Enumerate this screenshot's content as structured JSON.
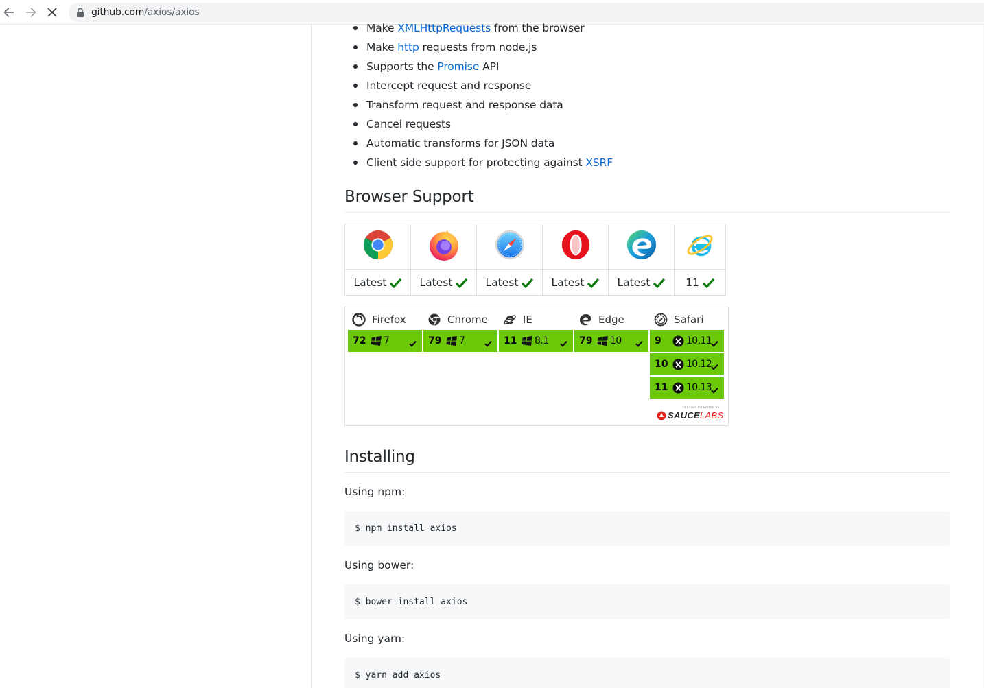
{
  "browser": {
    "url_host": "github.com",
    "url_path": "/axios/axios"
  },
  "features": [
    {
      "before": "Make ",
      "link": "XMLHttpRequests",
      "after": " from the browser"
    },
    {
      "before": "Make ",
      "link": "http",
      "after": " requests from node.js"
    },
    {
      "before": "Supports the ",
      "link": "Promise",
      "after": " API"
    },
    {
      "before": "Intercept request and response",
      "link": "",
      "after": ""
    },
    {
      "before": "Transform request and response data",
      "link": "",
      "after": ""
    },
    {
      "before": "Cancel requests",
      "link": "",
      "after": ""
    },
    {
      "before": "Automatic transforms for JSON data",
      "link": "",
      "after": ""
    },
    {
      "before": "Client side support for protecting against ",
      "link": "XSRF",
      "after": ""
    }
  ],
  "browser_support": {
    "heading": "Browser Support",
    "browsers": [
      {
        "icon": "chrome-logo-icon",
        "label": "Latest"
      },
      {
        "icon": "firefox-logo-icon",
        "label": "Latest"
      },
      {
        "icon": "safari-logo-icon",
        "label": "Latest"
      },
      {
        "icon": "opera-logo-icon",
        "label": "Latest"
      },
      {
        "icon": "edge-logo-icon",
        "label": "Latest"
      },
      {
        "icon": "ie-logo-icon",
        "label": "11"
      }
    ]
  },
  "sauce_matrix": {
    "columns": [
      {
        "name": "Firefox",
        "icon": "firefox-icon",
        "rows": [
          {
            "version": "72",
            "os": "7",
            "os_icon": "windows-icon"
          }
        ]
      },
      {
        "name": "Chrome",
        "icon": "chrome-icon",
        "rows": [
          {
            "version": "79",
            "os": "7",
            "os_icon": "windows-icon"
          }
        ]
      },
      {
        "name": "IE",
        "icon": "ie-icon",
        "rows": [
          {
            "version": "11",
            "os": "8.1",
            "os_icon": "windows-icon"
          }
        ]
      },
      {
        "name": "Edge",
        "icon": "edge-icon",
        "rows": [
          {
            "version": "79",
            "os": "10",
            "os_icon": "windows-icon"
          }
        ]
      },
      {
        "name": "Safari",
        "icon": "safari-icon",
        "rows": [
          {
            "version": "9",
            "os": "10.11",
            "os_icon": "macos-x-icon"
          },
          {
            "version": "10",
            "os": "10.12",
            "os_icon": "macos-x-icon"
          },
          {
            "version": "11",
            "os": "10.13",
            "os_icon": "macos-x-icon"
          }
        ]
      }
    ],
    "badge_small": "TESTING POWERED BY",
    "badge_brand_a": "SAUCE",
    "badge_brand_b": "LABS",
    "pass_color": "#6bc90a"
  },
  "installing": {
    "heading": "Installing",
    "npm_label": "Using npm:",
    "npm_cmd": "$ npm install axios",
    "bower_label": "Using bower:",
    "bower_cmd": "$ bower install axios",
    "yarn_label": "Using yarn:",
    "yarn_cmd": "$ yarn add axios"
  }
}
